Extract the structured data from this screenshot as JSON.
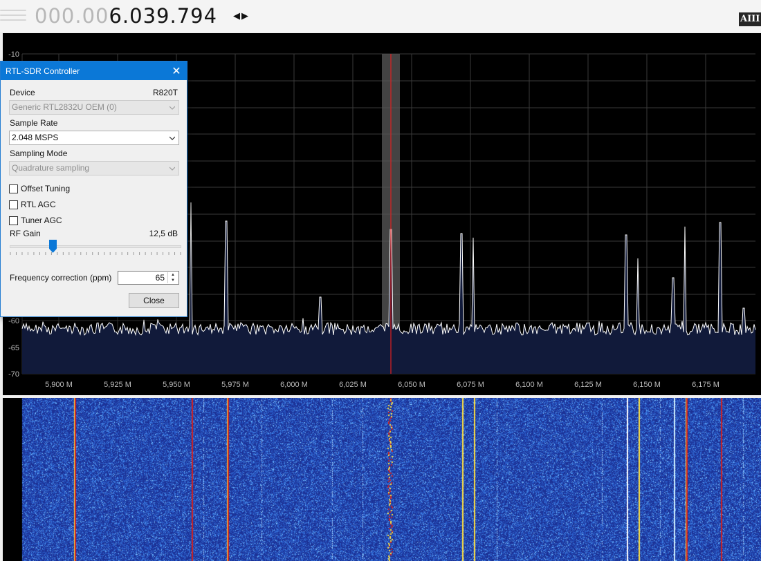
{
  "frequency": {
    "dim_digits": "000.00",
    "main_digits": "6.039.794"
  },
  "corner_logo": "AIII",
  "spectrum": {
    "y_ticks": [
      "-10",
      "-60",
      "-65",
      "-70"
    ],
    "x_ticks": [
      "5,900 M",
      "5,925 M",
      "5,950 M",
      "5,975 M",
      "6,000 M",
      "6,025 M",
      "6,050 M",
      "6,075 M",
      "6,100 M",
      "6,125 M",
      "6,150 M",
      "6,175 M"
    ],
    "colors": {
      "background": "#000000",
      "grid": "#3a3a3a",
      "trace": "#ffffff",
      "fill": "#111a3a",
      "tuning_line": "#e02020",
      "passband": "#5a5a5a",
      "label": "#bcbcbc"
    }
  },
  "dialog": {
    "title": "RTL-SDR Controller",
    "device_label": "Device",
    "device_tuner": "R820T",
    "device_value": "Generic RTL2832U OEM (0)",
    "sample_rate_label": "Sample Rate",
    "sample_rate_value": "2.048 MSPS",
    "sampling_mode_label": "Sampling Mode",
    "sampling_mode_value": "Quadrature sampling",
    "offset_tuning_label": "Offset Tuning",
    "rtl_agc_label": "RTL AGC",
    "tuner_agc_label": "Tuner AGC",
    "rf_gain_label": "RF Gain",
    "rf_gain_value": "12,5 dB",
    "rf_gain_fraction": 0.25,
    "freq_correction_label": "Frequency correction (ppm)",
    "freq_correction_value": "65",
    "close_label": "Close",
    "accent": "#0b78d7"
  },
  "waterfall": {
    "colors": {
      "base": "#1a2d8c",
      "mid": "#3f7fe0",
      "hot": "#ffe040",
      "peak": "#d02020"
    }
  }
}
